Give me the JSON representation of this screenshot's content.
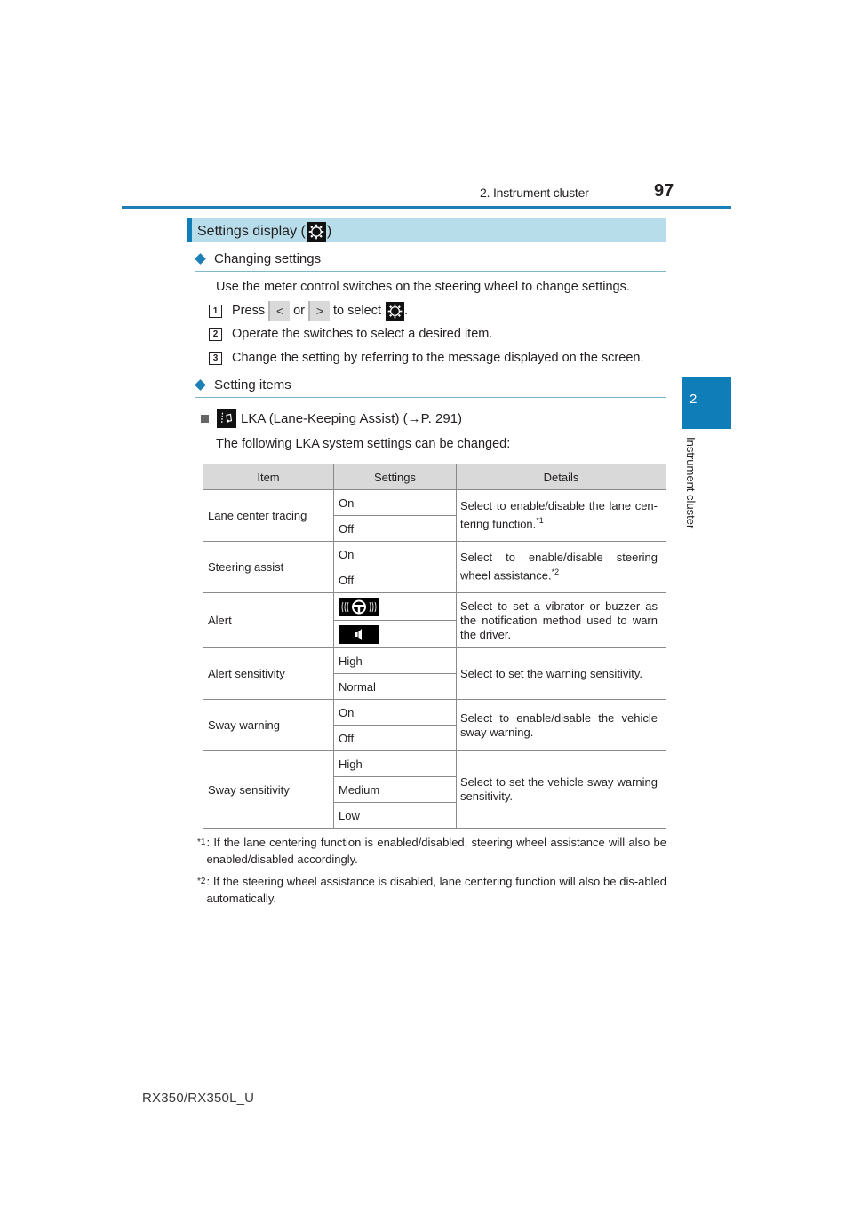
{
  "header": {
    "chapter_title": "2. Instrument cluster",
    "page_number": "97"
  },
  "side_tab": {
    "number": "2",
    "label": "Instrument cluster"
  },
  "section": {
    "title_prefix": "Settings display (",
    "title_suffix": ")",
    "icon": "gear-icon"
  },
  "changing_settings": {
    "heading": "Changing settings",
    "intro": "Use the meter control switches on the steering wheel to change settings.",
    "steps": [
      {
        "num": "1",
        "press": "Press",
        "left_btn": "<",
        "or": "or",
        "right_btn": ">",
        "to_select": "to select",
        "end": "."
      },
      {
        "num": "2",
        "text": "Operate the switches to select a desired item."
      },
      {
        "num": "3",
        "text": "Change the setting by referring to the message displayed on the screen."
      }
    ]
  },
  "setting_items": {
    "heading": "Setting items",
    "lka_title": "LKA (Lane-Keeping Assist) (→P. 291)",
    "lka_intro": "The following LKA system settings can be changed:"
  },
  "table": {
    "headers": [
      "Item",
      "Settings",
      "Details"
    ],
    "rows": [
      {
        "item": "Lane center tracing",
        "settings": [
          "On",
          "Off"
        ],
        "details": "Select to enable/disable the lane cen-tering function.",
        "note": "*1"
      },
      {
        "item": "Steering assist",
        "settings": [
          "On",
          "Off"
        ],
        "details": "Select to enable/disable steering wheel assistance.",
        "note": "*2"
      },
      {
        "item": "Alert",
        "settings": [
          "vibrator-steering-wheel-icon",
          "buzzer-speaker-icon"
        ],
        "details": "Select to set a vibrator or buzzer as the notification method used to warn the driver."
      },
      {
        "item": "Alert sensitivity",
        "settings": [
          "High",
          "Normal"
        ],
        "details": "Select to set the warning sensitivity."
      },
      {
        "item": "Sway warning",
        "settings": [
          "On",
          "Off"
        ],
        "details": "Select to enable/disable the vehicle sway warning."
      },
      {
        "item": "Sway sensitivity",
        "settings": [
          "High",
          "Medium",
          "Low"
        ],
        "details": "Select to set the vehicle sway warning sensitivity."
      }
    ]
  },
  "footnotes": [
    {
      "mark": "*1",
      "text": ": If the lane centering function is enabled/disabled, steering wheel assistance will also be enabled/disabled accordingly."
    },
    {
      "mark": "*2",
      "text": ": If the steering wheel assistance is disabled, lane centering function will also be dis-abled automatically."
    }
  ],
  "footer": {
    "model": "RX350/RX350L_U"
  }
}
